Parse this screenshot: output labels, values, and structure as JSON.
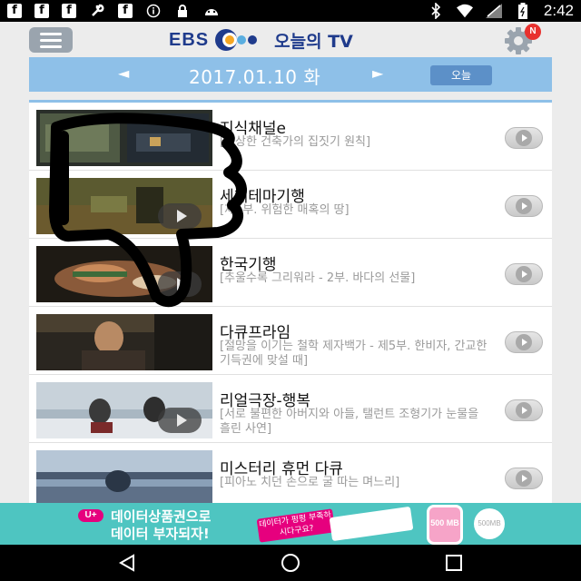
{
  "status_bar": {
    "time": "2:42",
    "left_icons": [
      "facebook-icon",
      "facebook-icon",
      "facebook-icon",
      "wrench-icon",
      "facebook-icon",
      "info-icon",
      "lock-icon",
      "android-icon"
    ],
    "right_icons": [
      "bluetooth-icon",
      "wifi-icon",
      "signal-icon",
      "battery-icon"
    ]
  },
  "header": {
    "brand": "EBS",
    "title": "오늘의 TV",
    "notification_badge": "N"
  },
  "date_bar": {
    "prev_symbol": "◄",
    "date": "2017.01.10 화",
    "next_symbol": "►",
    "today_label": "오늘"
  },
  "programs": [
    {
      "title": "지식채널e",
      "desc": "[이상한 건축가의 집짓기 원칙]",
      "has_play": false
    },
    {
      "title": "세계테마기행",
      "desc": "[제1부. 위험한 매혹의 땅]",
      "has_play": true
    },
    {
      "title": "한국기행",
      "desc": "[추울수록 그리워라 - 2부. 바다의 선물]",
      "has_play": true
    },
    {
      "title": "다큐프라임",
      "desc": "[절망을 이기는 철학 제자백가 - 제5부. 한비자, 간교한 기득권에 맞설 때]",
      "has_play": false
    },
    {
      "title": "리얼극장-행복",
      "desc": "[서로 불편한 아버지와 아들, 탤런트 조형기가 눈물을 흘린 사연]",
      "has_play": true
    },
    {
      "title": "미스터리 휴먼 다큐",
      "desc": "[피아노 치던 손으로 굴 따는 며느리]",
      "has_play": false
    }
  ],
  "ad": {
    "logo": "U+",
    "line1": "데이터상품권으로",
    "line2": "데이터 부자되자!",
    "sticker1": "데이터가 펑펑 부족하시다구요?",
    "phone_text": "500 MB",
    "circle_text": "500MB"
  },
  "colors": {
    "date_bar": "#8ec0e8",
    "today_button": "#5c90c8",
    "brand_blue": "#1f3b8c",
    "ad_background": "#4ec5c1",
    "badge_red": "#e8312e"
  }
}
